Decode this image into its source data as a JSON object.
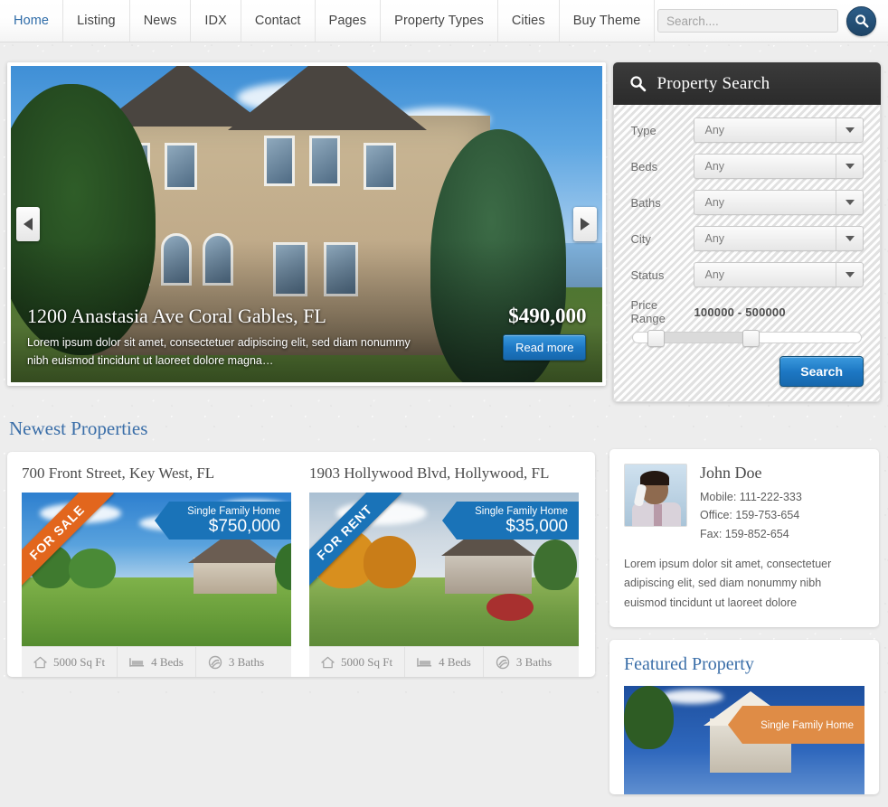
{
  "header": {
    "nav": [
      {
        "label": "Home",
        "active": true
      },
      {
        "label": "Listing",
        "active": false
      },
      {
        "label": "News",
        "active": false
      },
      {
        "label": "IDX",
        "active": false
      },
      {
        "label": "Contact",
        "active": false
      },
      {
        "label": "Pages",
        "active": false
      },
      {
        "label": "Property Types",
        "active": false
      },
      {
        "label": "Cities",
        "active": false
      },
      {
        "label": "Buy Theme",
        "active": false
      }
    ],
    "search": {
      "placeholder": "Search....",
      "value": "",
      "button_icon": "search-icon"
    }
  },
  "slider": {
    "prev_icon": "chevron-left-icon",
    "next_icon": "chevron-right-icon",
    "slide": {
      "title": "1200 Anastasia Ave Coral Gables, FL",
      "price": "$490,000",
      "description": "Lorem ipsum dolor sit amet, consectetuer adipiscing elit, sed diam nonummy nibh euismod tincidunt ut laoreet dolore magna…",
      "read_more": "Read more"
    }
  },
  "property_search": {
    "title": "Property Search",
    "title_icon": "search-icon",
    "fields": [
      {
        "label": "Type",
        "value": "Any"
      },
      {
        "label": "Beds",
        "value": "Any"
      },
      {
        "label": "Baths",
        "value": "Any"
      },
      {
        "label": "City",
        "value": "Any"
      },
      {
        "label": "Status",
        "value": "Any"
      }
    ],
    "price_range": {
      "label": "Price Range",
      "value": "100000 - 500000",
      "min": "100000",
      "max": "500000"
    },
    "submit_label": "Search"
  },
  "newest": {
    "heading": "Newest Properties",
    "properties": [
      {
        "title": "700 Front Street, Key West, FL",
        "type": "Single Family Home",
        "price": "$750,000",
        "flag": "FOR SALE",
        "flag_color": "#e2661d",
        "ribbon_color": "#1a73b8",
        "meta": [
          {
            "icon": "home-icon",
            "text": "5000 Sq Ft"
          },
          {
            "icon": "bed-icon",
            "text": "4 Beds"
          },
          {
            "icon": "bath-icon",
            "text": "3 Baths"
          }
        ]
      },
      {
        "title": "1903 Hollywood Blvd, Hollywood, FL",
        "type": "Single Family Home",
        "price": "$35,000",
        "flag": "FOR RENT",
        "flag_color": "#1a73b8",
        "ribbon_color": "#1a73b8",
        "meta": [
          {
            "icon": "home-icon",
            "text": "5000 Sq Ft"
          },
          {
            "icon": "bed-icon",
            "text": "4 Beds"
          },
          {
            "icon": "bath-icon",
            "text": "3 Baths"
          }
        ]
      }
    ]
  },
  "sidebar": {
    "agent": {
      "name": "John Doe",
      "photo_alt": "agent-photo",
      "mobile": "Mobile: 111-222-333",
      "office": "Office: 159-753-654",
      "fax": "Fax: 159-852-654",
      "description": "Lorem ipsum dolor sit amet, consectetuer adipiscing elit, sed diam nonummy nibh euismod tincidunt ut laoreet dolore"
    },
    "featured": {
      "heading": "Featured Property",
      "type": "Single Family Home",
      "ribbon_color": "#df8c46"
    }
  },
  "colors": {
    "accent_blue": "#3a6ea8",
    "link_blue": "#2f6ca8",
    "button_blue": "#1d78c4",
    "orange": "#e2661d",
    "panel_dark": "#2b2b2b"
  }
}
